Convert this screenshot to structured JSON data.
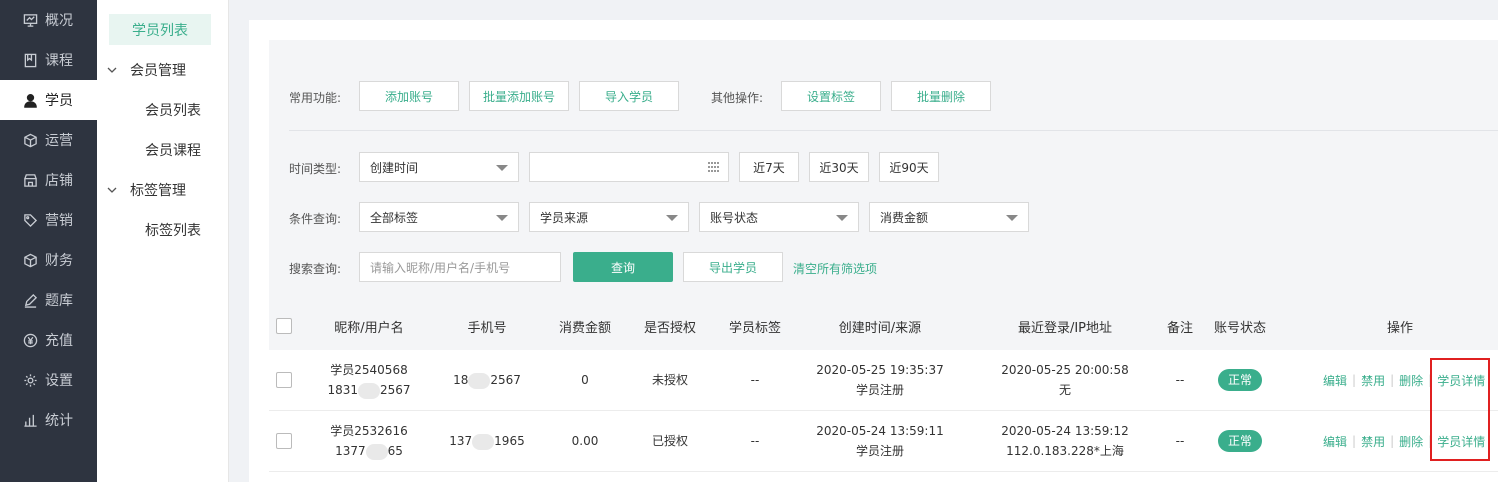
{
  "nav": [
    {
      "label": "概况",
      "icon": "monitor-icon"
    },
    {
      "label": "课程",
      "icon": "book-icon"
    },
    {
      "label": "学员",
      "icon": "user-icon"
    },
    {
      "label": "运营",
      "icon": "box-icon"
    },
    {
      "label": "店铺",
      "icon": "store-icon"
    },
    {
      "label": "营销",
      "icon": "tag-icon"
    },
    {
      "label": "财务",
      "icon": "cube-icon"
    },
    {
      "label": "题库",
      "icon": "pen-icon"
    },
    {
      "label": "充值",
      "icon": "yuan-icon"
    },
    {
      "label": "设置",
      "icon": "gear-icon"
    },
    {
      "label": "统计",
      "icon": "chart-icon"
    }
  ],
  "nav_active": "学员",
  "submenu": {
    "active": "学员列表",
    "groups": [
      {
        "label": "会员管理",
        "items": [
          "会员列表",
          "会员课程"
        ]
      },
      {
        "label": "标签管理",
        "items": [
          "标签列表"
        ]
      }
    ]
  },
  "filters": {
    "common_label": "常用功能:",
    "common_buttons": [
      "添加账号",
      "批量添加账号",
      "导入学员"
    ],
    "other_label": "其他操作:",
    "other_buttons": [
      "设置标签",
      "批量删除"
    ],
    "time_label": "时间类型:",
    "time_type": "创建时间",
    "date_value": "",
    "quick_ranges": [
      "近7天",
      "近30天",
      "近90天"
    ],
    "cond_label": "条件查询:",
    "cond_selects": [
      "全部标签",
      "学员来源",
      "账号状态",
      "消费金额"
    ],
    "search_label": "搜索查询:",
    "search_placeholder": "请输入昵称/用户名/手机号",
    "search_button": "查询",
    "export_button": "导出学员",
    "clear_link": "清空所有筛选项"
  },
  "table": {
    "headers": [
      "昵称/用户名",
      "手机号",
      "消费金额",
      "是否授权",
      "学员标签",
      "创建时间/来源",
      "最近登录/IP地址",
      "备注",
      "账号状态",
      "操作"
    ],
    "rows": [
      {
        "nickname": "学员2540568",
        "username_pre": "1831",
        "username_post": "2567",
        "phone_pre": "18",
        "phone_post": "2567",
        "amount": "0",
        "authorized": "未授权",
        "tags": "--",
        "created": "2020-05-25 19:35:37",
        "source": "学员注册",
        "last_login": "2020-05-25 20:00:58",
        "ip": "无",
        "remark": "--",
        "status": "正常",
        "ops": [
          "编辑",
          "禁用",
          "删除",
          "学员详情"
        ]
      },
      {
        "nickname": "学员2532616",
        "username_pre": "1377",
        "username_post": "65",
        "phone_pre": "137",
        "phone_post": "1965",
        "amount": "0.00",
        "authorized": "已授权",
        "tags": "--",
        "created": "2020-05-24 13:59:11",
        "source": "学员注册",
        "last_login": "2020-05-24 13:59:12",
        "ip": "112.0.183.228*上海",
        "remark": "--",
        "status": "正常",
        "ops": [
          "编辑",
          "禁用",
          "删除",
          "学员详情"
        ]
      }
    ]
  },
  "colors": {
    "accent": "#3aae8c",
    "nav_bg": "#2e3440",
    "highlight": "#e02020"
  }
}
